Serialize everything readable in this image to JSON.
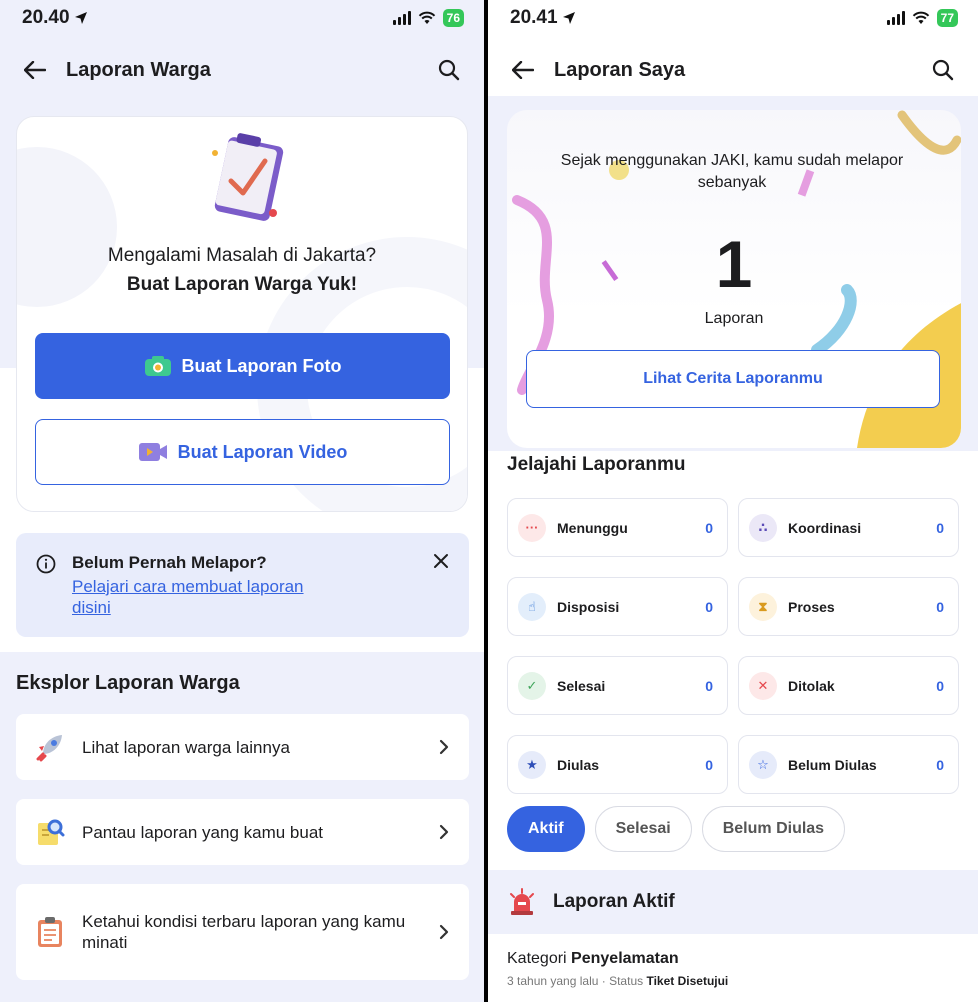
{
  "left": {
    "status_time": "20.40",
    "battery": "76",
    "header_title": "Laporan Warga",
    "hero_line1": "Mengalami Masalah di Jakarta?",
    "hero_line2": "Buat Laporan Warga Yuk!",
    "photo_button": "Buat Laporan Foto",
    "video_button": "Buat Laporan Video",
    "info_title": "Belum Pernah Melapor?",
    "info_link": "Pelajari cara membuat laporan disini",
    "explore_title": "Eksplor Laporan Warga",
    "explore_items": [
      {
        "label": "Lihat laporan warga lainnya",
        "icon": "rocket-icon"
      },
      {
        "label": "Pantau laporan yang kamu buat",
        "icon": "magnifier-note-icon"
      },
      {
        "label": "Ketahui kondisi terbaru laporan yang kamu minati",
        "icon": "clipboard-icon"
      }
    ]
  },
  "right": {
    "status_time": "20.41",
    "battery": "77",
    "header_title": "Laporan Saya",
    "stat_description": "Sejak menggunakan JAKI, kamu sudah melapor sebanyak",
    "stat_count": "1",
    "stat_unit": "Laporan",
    "story_button": "Lihat Cerita Laporanmu",
    "explore_title": "Jelajahi Laporanmu",
    "statuses": [
      {
        "label": "Menunggu",
        "value": "0",
        "icon": "dots-icon",
        "color": "#e5484d",
        "bg": "#fde8e8"
      },
      {
        "label": "Koordinasi",
        "value": "0",
        "icon": "triangle-dots-icon",
        "color": "#5b4bb7",
        "bg": "#ebe8f7"
      },
      {
        "label": "Disposisi",
        "value": "0",
        "icon": "hand-icon",
        "color": "#3b7bd6",
        "bg": "#e3eefb"
      },
      {
        "label": "Proses",
        "value": "0",
        "icon": "hourglass-icon",
        "color": "#d99a1e",
        "bg": "#fdf2dc"
      },
      {
        "label": "Selesai",
        "value": "0",
        "icon": "check-icon",
        "color": "#3fa55a",
        "bg": "#e4f4e8"
      },
      {
        "label": "Ditolak",
        "value": "0",
        "icon": "x-icon",
        "color": "#e5484d",
        "bg": "#fde8e8"
      },
      {
        "label": "Diulas",
        "value": "0",
        "icon": "star-circle-icon",
        "color": "#2f4fb8",
        "bg": "#e6ebfa"
      },
      {
        "label": "Belum Diulas",
        "value": "0",
        "icon": "star-outline-icon",
        "color": "#3563e0",
        "bg": "#e6ebfa"
      }
    ],
    "chips": [
      "Aktif",
      "Selesai",
      "Belum Diulas"
    ],
    "active_title": "Laporan Aktif",
    "report": {
      "category_prefix": "Kategori",
      "category": "Penyelamatan",
      "time": "3 tahun yang lalu",
      "status_prefix": "Status",
      "status": "Tiket Disetujui"
    }
  },
  "colors": {
    "primary": "#3563e0",
    "band": "#eef0fb"
  }
}
